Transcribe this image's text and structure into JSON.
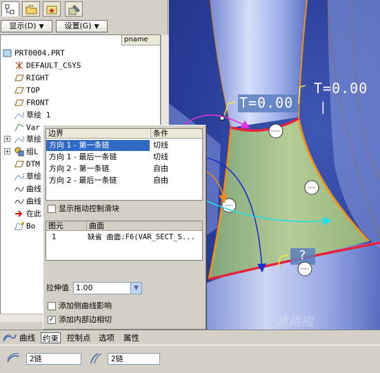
{
  "tree_toolbar": {
    "display_label": "显示(D)",
    "settings_label": "设置(G)"
  },
  "tree": {
    "column_header": "pname",
    "items": [
      {
        "label": "PRT0004.PRT",
        "icon": "part-icon"
      },
      {
        "label": "DEFAULT_CSYS",
        "icon": "csys-icon"
      },
      {
        "label": "RIGHT",
        "icon": "datum-plane-icon"
      },
      {
        "label": "TOP",
        "icon": "datum-plane-icon"
      },
      {
        "label": "FRONT",
        "icon": "datum-plane-icon"
      },
      {
        "label": "草绘 1",
        "icon": "sketch-icon"
      },
      {
        "label": "Var",
        "icon": "sweep-icon"
      },
      {
        "label": "草绘",
        "icon": "sketch-icon"
      },
      {
        "label": "组L",
        "icon": "group-icon"
      },
      {
        "label": "DTM",
        "icon": "datum-plane-icon"
      },
      {
        "label": "草绘",
        "icon": "sketch-icon"
      },
      {
        "label": "曲线",
        "icon": "curve-icon"
      },
      {
        "label": "曲线",
        "icon": "curve-icon"
      },
      {
        "label": "在此",
        "icon": "insert-arrow-icon"
      },
      {
        "label": "Bo",
        "icon": "boundary-blend-icon"
      }
    ]
  },
  "constraints_panel": {
    "table_headers": {
      "boundary": "边界",
      "condition": "条件"
    },
    "rows": [
      {
        "boundary": "方向 1 - 第一条链",
        "condition": "切线",
        "selected": true
      },
      {
        "boundary": "方向 1 - 最后一条链",
        "condition": "切线",
        "selected": false
      },
      {
        "boundary": "方向 2 - 第一条链",
        "condition": "自由",
        "selected": false
      },
      {
        "boundary": "方向 2 - 最后一条链",
        "condition": "自由",
        "selected": false
      }
    ],
    "show_drag_handles": {
      "label": "显示拖动控制滑块",
      "checked": false
    },
    "curve_table": {
      "headers": {
        "element": "图元",
        "surface": "曲面"
      },
      "row": {
        "element": "1",
        "surface": "缺省 曲面:F6(VAR_SECT_S..."
      }
    },
    "stretch_value": {
      "label": "拉伸值",
      "value": "1.00"
    },
    "add_side_curve_influence": {
      "label": "添加侧曲线影响",
      "checked": false
    },
    "add_inner_edge_tangency": {
      "label": "添加内部边相切",
      "checked": true
    }
  },
  "viewport": {
    "labels": [
      "T=0.00",
      "T=0.00"
    ],
    "watermark": "冰指指",
    "colors": {
      "background": "#2a3f9a",
      "surface": "#a9c28a",
      "chain_red": "#e8203a",
      "chain_orange": "#f0901a"
    }
  },
  "dashboard": {
    "tabs": [
      {
        "label": "曲线",
        "active": false
      },
      {
        "label": "约束",
        "active": true
      },
      {
        "label": "控制点",
        "active": false
      },
      {
        "label": "选项",
        "active": false
      },
      {
        "label": "属性",
        "active": false
      }
    ],
    "field1": "2链",
    "field2": "2链"
  }
}
